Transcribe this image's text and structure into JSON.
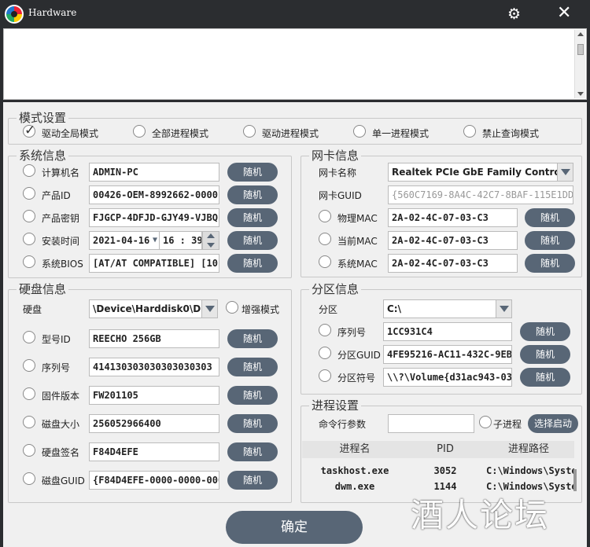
{
  "window": {
    "title": "Hardware"
  },
  "mode": {
    "title": "模式设置",
    "options": [
      "驱动全局模式",
      "全部进程模式",
      "驱动进程模式",
      "单一进程模式",
      "禁止查询模式"
    ]
  },
  "system": {
    "title": "系统信息",
    "computer_name": {
      "label": "计算机名",
      "value": "ADMIN-PC"
    },
    "product_id": {
      "label": "产品ID",
      "value": "00426-OEM-8992662-0000"
    },
    "product_key": {
      "label": "产品密钥",
      "value": "FJGCP-4DFJD-GJY49-VJBQ"
    },
    "install_time": {
      "label": "安装时间",
      "date": "2021-04-16",
      "time": "16 : 39"
    },
    "bios": {
      "label": "系统BIOS",
      "value": "[AT/AT COMPATIBLE] [10"
    }
  },
  "nic": {
    "title": "网卡信息",
    "name": {
      "label": "网卡名称",
      "value": "Realtek PCIe GbE Family Controll"
    },
    "guid": {
      "label": "网卡GUID",
      "value": "{560C7169-8A4C-42C7-8BAF-115E1DD"
    },
    "physical_mac": {
      "label": "物理MAC",
      "value": "2A-02-4C-07-03-C3"
    },
    "current_mac": {
      "label": "当前MAC",
      "value": "2A-02-4C-07-03-C3"
    },
    "system_mac": {
      "label": "系统MAC",
      "value": "2A-02-4C-07-03-C3"
    }
  },
  "disk": {
    "title": "硬盘信息",
    "disk": {
      "label": "硬盘",
      "value": "\\Device\\Harddisk0\\DI"
    },
    "enhanced_label": "增强模式",
    "model_id": {
      "label": "型号ID",
      "value": "REECHO 256GB"
    },
    "serial": {
      "label": "序列号",
      "value": "414130303030303030303"
    },
    "firmware": {
      "label": "固件版本",
      "value": "FW201105"
    },
    "size": {
      "label": "磁盘大小",
      "value": "256052966400"
    },
    "signature": {
      "label": "硬盘签名",
      "value": "F84D4EFE"
    },
    "guid": {
      "label": "磁盘GUID",
      "value": "{F84D4EFE-0000-0000-000"
    }
  },
  "partition": {
    "title": "分区信息",
    "partition": {
      "label": "分区",
      "value": "C:\\"
    },
    "serial": {
      "label": "序列号",
      "value": "1CC931C4"
    },
    "guid": {
      "label": "分区GUID",
      "value": "4FE95216-AC11-432C-9EBI"
    },
    "symbol": {
      "label": "分区符号",
      "value": "\\\\?\\Volume{d31ac943-03f"
    }
  },
  "process": {
    "title": "进程设置",
    "cmd_label": "命令行参数",
    "cmd_value": "",
    "child_label": "子进程",
    "select_start": "选择启动",
    "columns": [
      "进程名",
      "PID",
      "进程路径"
    ],
    "rows": [
      {
        "name": "taskhost.exe",
        "pid": "3052",
        "path": "C:\\Windows\\Syster"
      },
      {
        "name": "dwm.exe",
        "pid": "1144",
        "path": "C:\\Windows\\Syster"
      }
    ]
  },
  "random_label": "随机",
  "confirm_label": "确定",
  "watermark": "酒人论坛"
}
